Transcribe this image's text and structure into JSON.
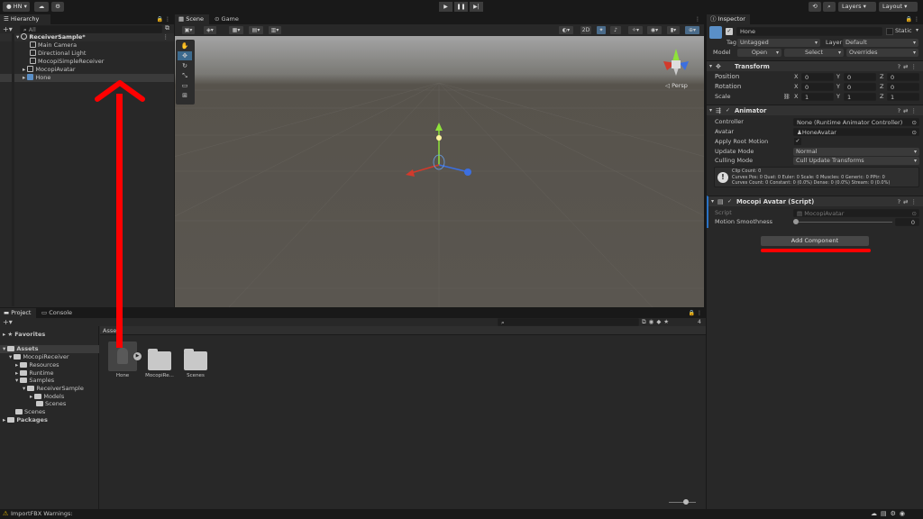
{
  "topbar": {
    "account": "HN",
    "layers": "Layers",
    "layout": "Layout"
  },
  "hierarchy": {
    "tab": "Hierarchy",
    "search_placeholder": "All",
    "rows": [
      {
        "label": "ReceiverSample*"
      },
      {
        "label": "Main Camera"
      },
      {
        "label": "Directional Light"
      },
      {
        "label": "MocopiSimpleReceiver"
      },
      {
        "label": "MocopiAvatar"
      },
      {
        "label": "Hone"
      }
    ]
  },
  "scene": {
    "tabs": [
      "Scene",
      "Game"
    ],
    "toggle_2d": "2D",
    "persp": "◁ Persp"
  },
  "inspector": {
    "tab": "Inspector",
    "object_name": "Hone",
    "static_label": "Static",
    "tag_label": "Tag",
    "tag_value": "Untagged",
    "layer_label": "Layer",
    "layer_value": "Default",
    "model_label": "Model",
    "open_btn": "Open",
    "select_btn": "Select",
    "overrides": "Overrides",
    "transform": {
      "title": "Transform",
      "position_label": "Position",
      "rotation_label": "Rotation",
      "scale_label": "Scale",
      "position": [
        "0",
        "0",
        "0"
      ],
      "rotation": [
        "0",
        "0",
        "0"
      ],
      "scale": [
        "1",
        "1",
        "1"
      ]
    },
    "animator": {
      "title": "Animator",
      "controller_label": "Controller",
      "controller_value": "None (Runtime Animator Controller)",
      "avatar_label": "Avatar",
      "avatar_value": "HoneAvatar",
      "root_motion_label": "Apply Root Motion",
      "update_mode_label": "Update Mode",
      "update_mode_value": "Normal",
      "culling_label": "Culling Mode",
      "culling_value": "Cull Update Transforms",
      "info_line1": "Clip Count: 0",
      "info_line2": "Curves Pos: 0 Quat: 0 Euler: 0 Scale: 0 Muscles: 0 Generic: 0 PPtr: 0",
      "info_line3": "Curves Count: 0 Constant: 0 (0.0%) Dense: 0 (0.0%) Stream: 0 (0.0%)"
    },
    "mocopi": {
      "title": "Mocopi Avatar (Script)",
      "script_label": "Script",
      "script_value": "MocopiAvatar",
      "smoothness_label": "Motion Smoothness",
      "smoothness_value": "0"
    },
    "add_component": "Add Component"
  },
  "project": {
    "tabs": [
      "Project",
      "Console"
    ],
    "favorites": "Favorites",
    "assets": "Assets",
    "tree": [
      {
        "label": "MocopiReceiver"
      },
      {
        "label": "Resources"
      },
      {
        "label": "Runtime"
      },
      {
        "label": "Samples"
      },
      {
        "label": "ReceiverSample"
      },
      {
        "label": "Models"
      },
      {
        "label": "Scenes"
      },
      {
        "label": "Scenes"
      },
      {
        "label": "Packages"
      }
    ],
    "breadcrumb": "Assets",
    "badge": "4",
    "items": [
      {
        "label": "Hone"
      },
      {
        "label": "MocopiRe..."
      },
      {
        "label": "Scenes"
      }
    ]
  },
  "status": {
    "message": "ImportFBX Warnings:"
  },
  "colors": {
    "annotation_red": "#ff0000",
    "selection_blue": "#2c5d87"
  }
}
